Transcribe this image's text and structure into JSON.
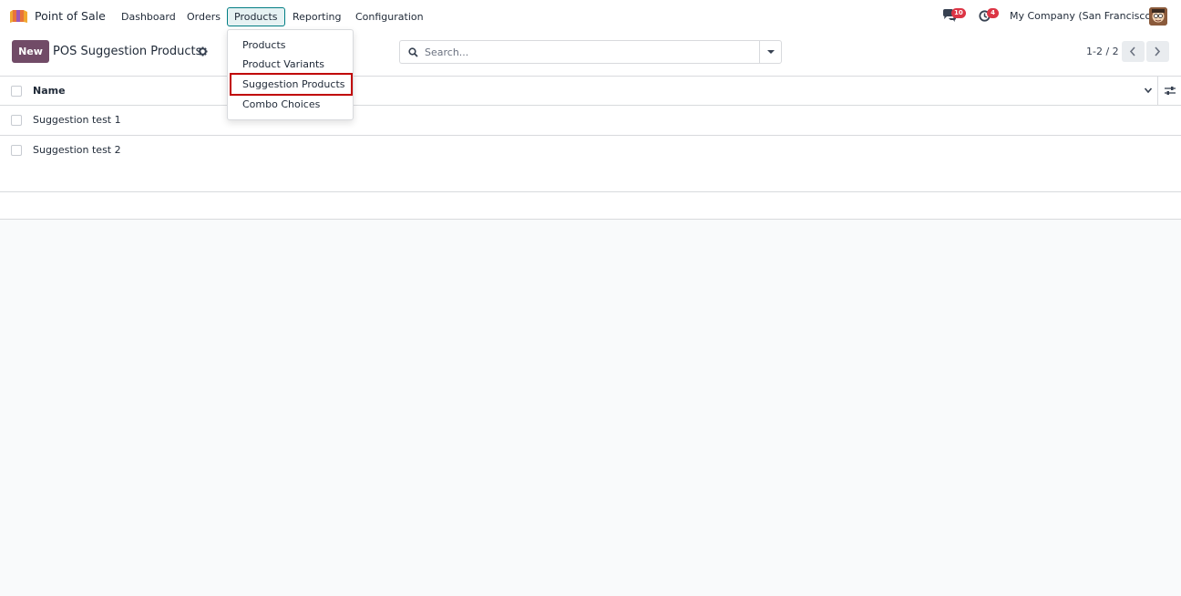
{
  "navbar": {
    "app_name": "Point of Sale",
    "menu": [
      {
        "label": "Dashboard"
      },
      {
        "label": "Orders"
      },
      {
        "label": "Products"
      },
      {
        "label": "Reporting"
      },
      {
        "label": "Configuration"
      }
    ],
    "systray": {
      "messages_count": "10",
      "activities_count": "4",
      "company": "My Company (San Francisco)"
    }
  },
  "control_panel": {
    "new_label": "New",
    "title": "POS Suggestion Products",
    "search_placeholder": "Search...",
    "pager": "1-2 / 2"
  },
  "list": {
    "columns": [
      "Name"
    ],
    "rows": [
      {
        "name": "Suggestion test 1"
      },
      {
        "name": "Suggestion test 2"
      }
    ]
  },
  "dropdown": {
    "items": [
      {
        "label": "Products"
      },
      {
        "label": "Product Variants"
      },
      {
        "label": "Suggestion Products"
      },
      {
        "label": "Combo Choices"
      }
    ]
  },
  "colors": {
    "brand_primary": "#714b67",
    "active_menu_border": "#017e84",
    "badge": "#dc3545",
    "highlight_box": "#c00000"
  }
}
